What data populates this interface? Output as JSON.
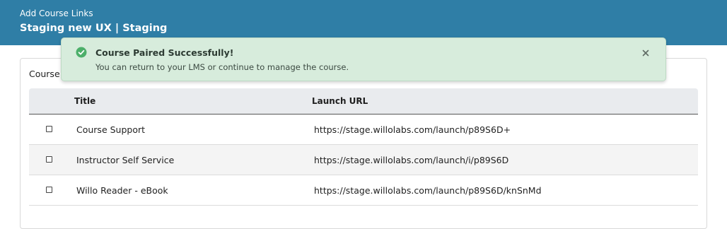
{
  "header": {
    "subtitle": "Add Course Links",
    "title": "Staging new UX | Staging",
    "background": "#2f7ea6"
  },
  "card": {
    "title": "Course"
  },
  "table": {
    "columns": [
      "Title",
      "Launch URL"
    ],
    "rows": [
      {
        "title": "Course Support",
        "url": "https://stage.willolabs.com/launch/p89S6D+"
      },
      {
        "title": "Instructor Self Service",
        "url": "https://stage.willolabs.com/launch/i/p89S6D"
      },
      {
        "title": "Willo Reader - eBook",
        "url": "https://stage.willolabs.com/launch/p89S6D/knSnMd"
      }
    ]
  },
  "toast": {
    "title": "Course Paired Successfully!",
    "message": "You can return to your LMS or continue to manage the course.",
    "icon": "check-circle-icon",
    "close_icon": "close-icon",
    "color": "#4caf6a"
  }
}
